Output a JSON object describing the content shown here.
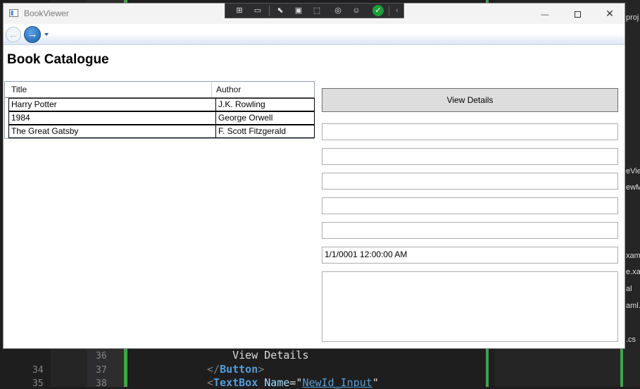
{
  "ide": {
    "line_numbers": [
      "34",
      "35"
    ],
    "inner_line_numbers": [
      "36",
      "37",
      "38"
    ],
    "code_lines": [
      {
        "indent": "    ",
        "text": "View Details"
      },
      {
        "bracket_open": "</",
        "tag": "Button",
        "bracket_close": ">"
      },
      {
        "bracket_open": "<",
        "tag": "TextBox",
        "attr": "Name",
        "eq": "=\"",
        "value": "NewId_Input",
        "quote": "\""
      }
    ],
    "side_snippets": [
      "proj",
      "eVie",
      "ewM",
      "xam",
      "e.xa",
      "al",
      "aml.",
      ".cs"
    ],
    "colors": {
      "bg": "#1e1e1e",
      "keyword": "#569cd6",
      "attr": "#9cdcfe",
      "string": "#d69d85",
      "green": "#3fa348"
    }
  },
  "window": {
    "title": "BookViewer",
    "controls": {
      "minimize": "—",
      "maximize": "□",
      "close": "✕"
    },
    "debug_toolbar": {
      "icons": [
        "live-visual-tree-icon",
        "record-icon",
        "select-element-icon",
        "display-layout-icon",
        "track-focus-icon",
        "hot-reload-icon",
        "accessibility-icon",
        "no-issues-check-icon",
        "collapse-icon"
      ],
      "check_color": "#1f9e3a"
    }
  },
  "nav": {
    "back": "back-arrow-icon",
    "forward": "forward-arrow-icon",
    "dropdown": "history-dropdown-icon"
  },
  "page": {
    "title": "Book Catalogue",
    "grid": {
      "columns": [
        "Title",
        "Author"
      ],
      "rows": [
        {
          "title": "Harry Potter",
          "author": "J.K. Rowling"
        },
        {
          "title": "1984",
          "author": "George Orwell"
        },
        {
          "title": "The Great Gatsby",
          "author": "F. Scott Fitzgerald"
        }
      ]
    },
    "view_button": "View Details",
    "fields": [
      "",
      "",
      "",
      "",
      "",
      "1/1/0001 12:00:00 AM",
      ""
    ]
  }
}
